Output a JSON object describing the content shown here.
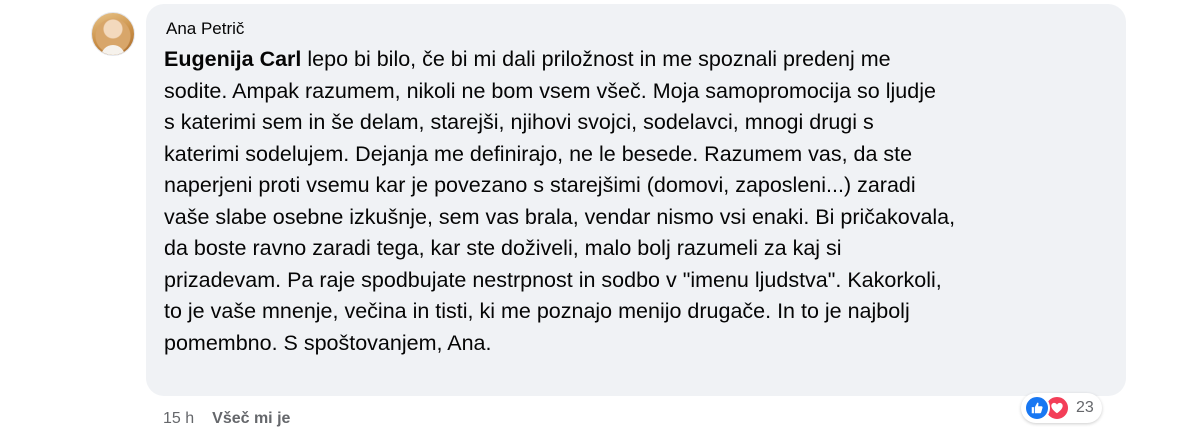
{
  "comment": {
    "author": "Ana Petrič",
    "mention": "Eugenija Carl",
    "lines": [
      " lepo bi bilo, če bi mi dali priložnost in me spoznali predenj me",
      "sodite. Ampak razumem, nikoli ne bom vsem všeč. Moja samopromocija so ljudje",
      "s katerimi sem in še delam, starejši, njihovi svojci, sodelavci, mnogi drugi s",
      "katerimi sodelujem. Dejanja me definirajo, ne le besede. Razumem vas, da ste",
      "naperjeni proti vsemu kar je povezano s starejšimi (domovi, zaposleni...) zaradi",
      "vaše slabe osebne izkušnje, sem vas brala, vendar nismo vsi enaki. Bi pričakovala,",
      "da boste ravno zaradi tega, kar ste doživeli, malo bolj razumeli za kaj si",
      "prizadevam. Pa raje spodbujate nestrpnost in sodbo v \"imenu ljudstva\". Kakorkoli,",
      "to je vaše mnenje, večina in tisti, ki me poznajo menijo drugače. In to je najbolj",
      "pomembno. S spoštovanjem, Ana."
    ]
  },
  "footer": {
    "time": "15 h",
    "like_label": "Všeč mi je"
  },
  "reactions": {
    "icons": [
      "like-icon",
      "love-icon"
    ],
    "count": "23",
    "colors": {
      "like": "#1877f2",
      "love": "#f33e58"
    }
  },
  "colors": {
    "bubble": "#f0f2f5",
    "text": "#050505",
    "secondary_text": "#65676b"
  }
}
